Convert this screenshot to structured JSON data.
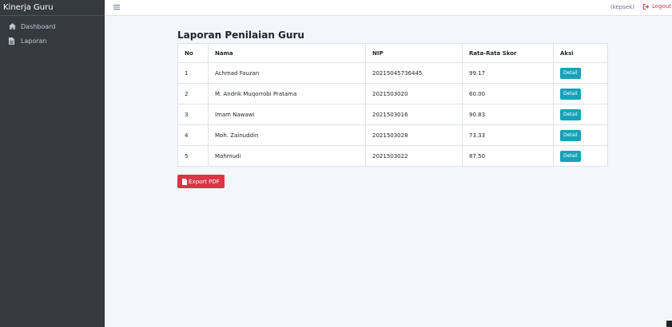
{
  "sidebar": {
    "brand": "Kinerja Guru",
    "items": [
      {
        "label": "Dashboard",
        "icon": "home-icon"
      },
      {
        "label": "Laporan",
        "icon": "file-icon"
      }
    ]
  },
  "topbar": {
    "menu_icon": "hamburger-icon",
    "user": "(kepsek)",
    "logout_label": "Logout"
  },
  "main": {
    "title": "Laporan Penilaian Guru",
    "table": {
      "headers": [
        "No",
        "Nama",
        "NIP",
        "Rata-Rata Skor",
        "Aksi"
      ],
      "rows": [
        {
          "no": "1",
          "nama": "Achmad Fauzan",
          "nip": "20215045736445",
          "skor": "99.17",
          "aksi": "Detail"
        },
        {
          "no": "2",
          "nama": "M. Andrik Muqorrobi Pratama",
          "nip": "2021503020",
          "skor": "60.00",
          "aksi": "Detail"
        },
        {
          "no": "3",
          "nama": "Imam Nawawi",
          "nip": "2021503016",
          "skor": "90.83",
          "aksi": "Detail"
        },
        {
          "no": "4",
          "nama": "Moh. Zainuddin",
          "nip": "2021503028",
          "skor": "73.33",
          "aksi": "Detail"
        },
        {
          "no": "5",
          "nama": "Mahmudi",
          "nip": "2021503022",
          "skor": "87.50",
          "aksi": "Detail"
        }
      ]
    },
    "export_label": "Export PDF"
  },
  "colors": {
    "sidebar_bg": "#343a40",
    "page_bg": "#f4f6f9",
    "detail_btn": "#17a2b8",
    "export_btn": "#dc3545",
    "logout": "#dc3545"
  }
}
